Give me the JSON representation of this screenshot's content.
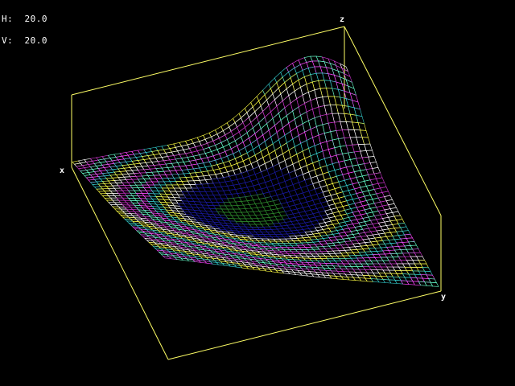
{
  "readout": {
    "h_label": "H:",
    "h_value": "20.0",
    "v_label": "V:",
    "v_value": "20.0"
  },
  "axes": {
    "x_label": "x",
    "y_label": "y",
    "z_label": "z"
  },
  "colors": {
    "background": "#000000",
    "box": "#ffff66",
    "bands": [
      "#ff3333",
      "#ff44ff",
      "#cc33cc",
      "#33cccc",
      "#66ffcc",
      "#ffffff",
      "#ffff44",
      "#1a1aa0",
      "#2e8b2e",
      "#3355ff",
      "#00cc66"
    ]
  },
  "view": {
    "rotation_h_deg": 20.0,
    "rotation_v_deg": 20.0,
    "render_mode": "wireframe-mesh"
  }
}
